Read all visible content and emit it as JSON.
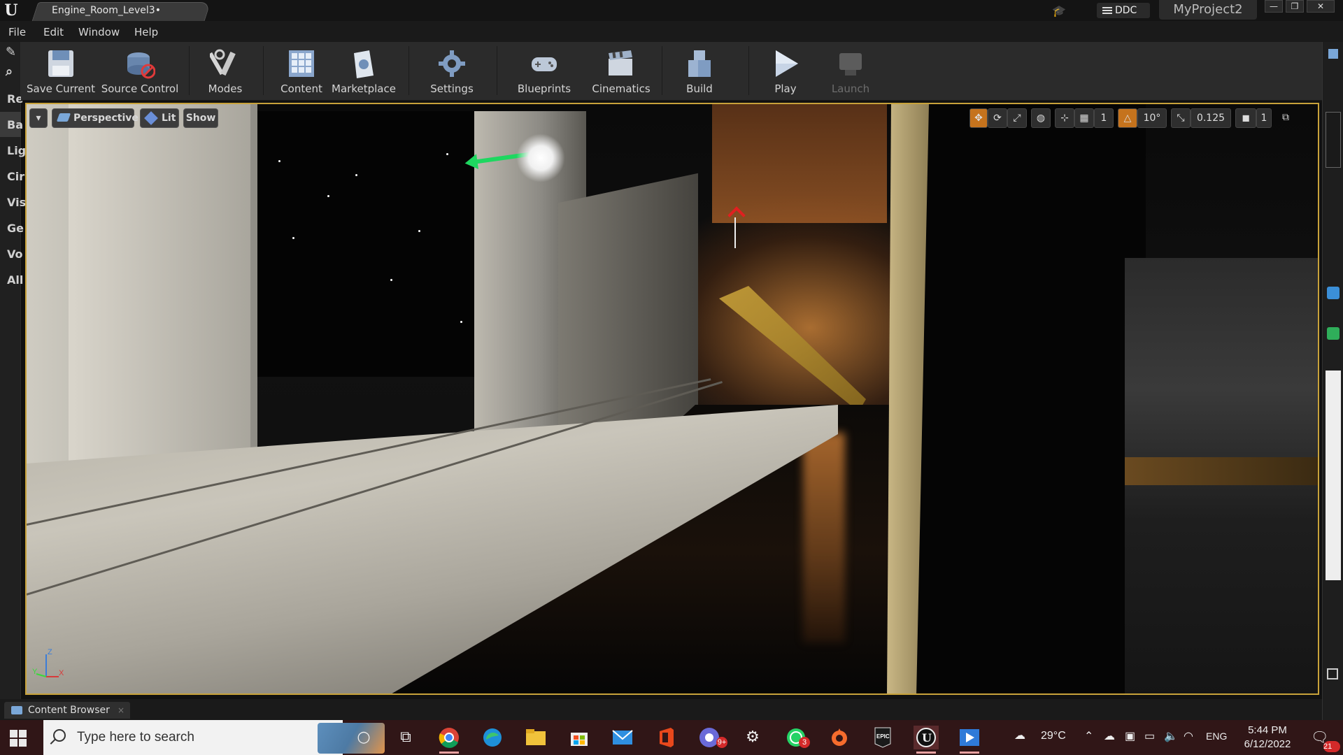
{
  "titlebar": {
    "doc_tab": "Engine_Room_Level3•",
    "ddc_label": "DDC",
    "project_name": "MyProject2",
    "win_minimize": "—",
    "win_restore": "❐",
    "win_close": "✕"
  },
  "menu": [
    "File",
    "Edit",
    "Window",
    "Help"
  ],
  "left_panel": {
    "items": [
      "Re",
      "Ba",
      "Lig",
      "Cir",
      "Vis",
      "Ge",
      "Vo",
      "All"
    ],
    "active_index": 1
  },
  "toolbar": {
    "save_current": "Save Current",
    "source_control": "Source Control",
    "modes": "Modes",
    "content": "Content",
    "marketplace": "Marketplace",
    "settings": "Settings",
    "blueprints": "Blueprints",
    "cinematics": "Cinematics",
    "build": "Build",
    "play": "Play",
    "launch": "Launch"
  },
  "viewport": {
    "perspective": "Perspective",
    "lit": "Lit",
    "show": "Show",
    "rotation_snap": "10°",
    "scale_snap": "0.125",
    "grid_snap": "1",
    "camera_speed": "1",
    "axis_z": "Z",
    "axis_x": "X",
    "axis_y": "Y"
  },
  "content_browser": {
    "tab_label": "Content Browser",
    "close": "×"
  },
  "taskbar": {
    "search_placeholder": "Type here to search",
    "weather": "29°C",
    "language": "ENG",
    "time": "5:44 PM",
    "date": "6/12/2022",
    "notification_count": "21",
    "whatsapp_badge": "3",
    "chrome_badge": "9+"
  },
  "colors": {
    "viewport_border": "#c8a23a",
    "taskbar_bg": "#301617",
    "gizmo_green": "#1ed760",
    "accent_orange": "#c5731d"
  }
}
